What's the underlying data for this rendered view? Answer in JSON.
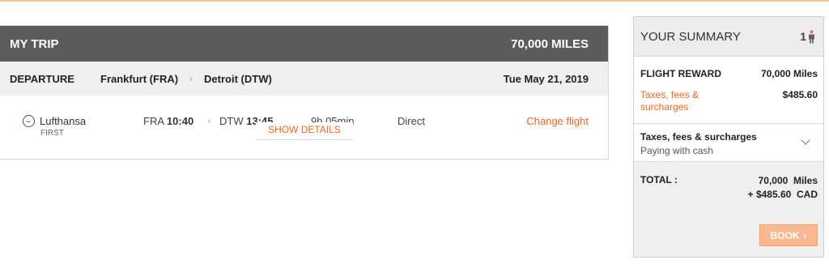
{
  "trip": {
    "title": "MY TRIP",
    "total_miles": "70,000 MILES",
    "departure": {
      "label": "DEPARTURE",
      "origin": "Frankfurt (FRA)",
      "destination": "Detroit (DTW)",
      "date": "Tue May 21, 2019"
    },
    "flight": {
      "airline": "Lufthansa",
      "cabin": "FIRST",
      "from_code": "FRA",
      "from_time": "10:40",
      "to_code": "DTW",
      "to_time": "13:45",
      "duration": "9h 05min",
      "stops": "Direct",
      "change_label": "Change flight"
    },
    "show_details_label": "SHOW DETAILS"
  },
  "summary": {
    "title": "YOUR SUMMARY",
    "passenger_count": "1",
    "reward_label": "FLIGHT REWARD",
    "reward_value": "70,000 Miles",
    "taxes_label": "Taxes, fees & surcharges",
    "taxes_value": "$485.60",
    "cash_title": "Taxes, fees & surcharges",
    "cash_sub": "Paying with cash",
    "total_label": "TOTAL :",
    "total_miles": "70,000  Miles",
    "total_cash": "+ $485.60  CAD",
    "book_label": "BOOK"
  },
  "colors": {
    "accent": "#f26522",
    "header_bg": "#5c5c5c",
    "book_button": "#f9b88f"
  },
  "icons": [
    "lufthansa-logo-icon",
    "chevron-right-icon",
    "passenger-icon",
    "chevron-down-icon"
  ]
}
